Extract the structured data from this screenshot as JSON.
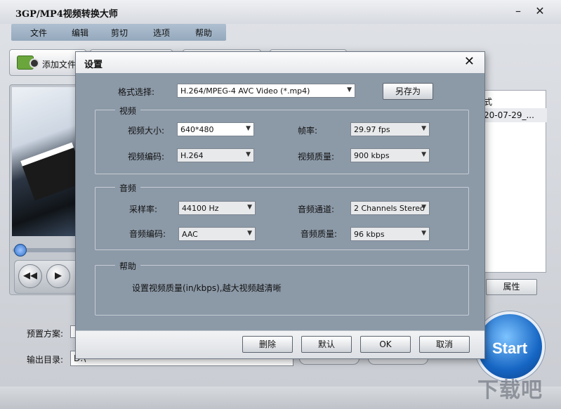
{
  "app": {
    "title": "3GP/MP4视频转换大师",
    "minimize_glyph": "–",
    "close_glyph": "✕"
  },
  "menu": [
    "文件",
    "编辑",
    "剪切",
    "选项",
    "帮助"
  ],
  "toolbar": {
    "add_file_label": "添加文件",
    "add_file_icon": "folder-film-icon"
  },
  "file_list": {
    "header": "式",
    "row": "20-07-29_..."
  },
  "properties_button": "属性",
  "preset_label": "预置方案:",
  "output_label": "输出目录:",
  "output_value": "D:\\",
  "start_label": "Start",
  "watermark": "下载吧",
  "dialog": {
    "title": "设置",
    "close_glyph": "✕",
    "format_label": "格式选择:",
    "format_value": "H.264/MPEG-4 AVC Video (*.mp4)",
    "save_as": "另存为",
    "video": {
      "title": "视频",
      "size_label": "视频大小:",
      "size_value": "640*480",
      "fps_label": "帧率:",
      "fps_value": "29.97 fps",
      "codec_label": "视频编码:",
      "codec_value": "H.264",
      "quality_label": "视频质量:",
      "quality_value": "900 kbps"
    },
    "audio": {
      "title": "音频",
      "samplerate_label": "采样率:",
      "samplerate_value": "44100 Hz",
      "channels_label": "音频通道:",
      "channels_value": "2 Channels Stereo",
      "codec_label": "音频编码:",
      "codec_value": "AAC",
      "quality_label": "音频质量:",
      "quality_value": "96 kbps"
    },
    "help": {
      "title": "帮助",
      "text": "设置视频质量(in/kbps),越大视频越清晰"
    },
    "buttons": {
      "delete": "删除",
      "default": "默认",
      "ok": "OK",
      "cancel": "取消"
    }
  }
}
